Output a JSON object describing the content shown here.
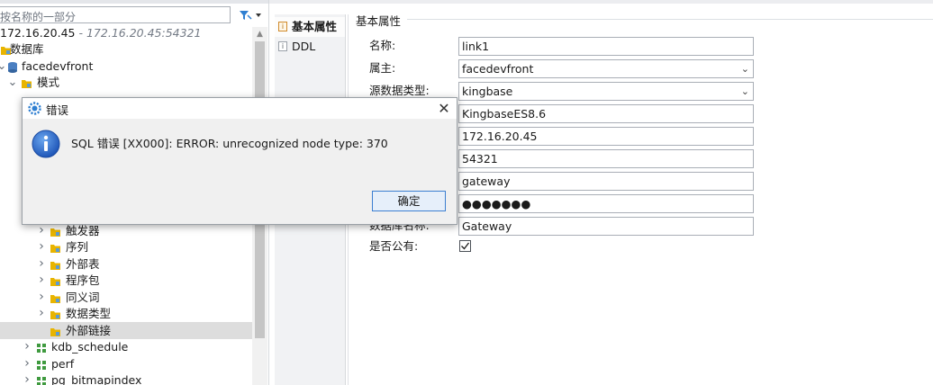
{
  "tree": {
    "filter_placeholder": "按名称的一部分",
    "connection": {
      "host": "172.16.20.45",
      "detail": "- 172.16.20.45:54321"
    },
    "rows": [
      {
        "label": "数据库",
        "chevron": "",
        "icon": "folder"
      },
      {
        "label": "facedevfront",
        "chevron": "v",
        "icon": "db"
      },
      {
        "label": "模式",
        "chevron": "v",
        "icon": "folder"
      },
      {
        "label": "触发器",
        "chevron": ">",
        "icon": "folder"
      },
      {
        "label": "序列",
        "chevron": ">",
        "icon": "folder"
      },
      {
        "label": "外部表",
        "chevron": ">",
        "icon": "folder"
      },
      {
        "label": "程序包",
        "chevron": ">",
        "icon": "folder"
      },
      {
        "label": "同义词",
        "chevron": ">",
        "icon": "folder"
      },
      {
        "label": "数据类型",
        "chevron": ">",
        "icon": "folder"
      },
      {
        "label": "外部链接",
        "chevron": "",
        "icon": "folder"
      },
      {
        "label": "kdb_schedule",
        "chevron": ">",
        "icon": "schema"
      },
      {
        "label": "perf",
        "chevron": ">",
        "icon": "schema"
      },
      {
        "label": "pg_bitmapindex",
        "chevron": ">",
        "icon": "schema"
      }
    ]
  },
  "tabs": [
    {
      "label": "基本属性",
      "active": true
    },
    {
      "label": "DDL",
      "active": false
    }
  ],
  "panel": {
    "section_title": "基本属性",
    "fields": [
      {
        "label": "名称:",
        "value": "link1",
        "dropdown": false
      },
      {
        "label": "属主:",
        "value": "facedevfront",
        "dropdown": true
      },
      {
        "label": "源数据类型:",
        "value": "kingbase",
        "dropdown": true
      },
      {
        "label": "",
        "value": "KingbaseES8.6",
        "dropdown": false
      },
      {
        "label": "",
        "value": "172.16.20.45",
        "dropdown": false
      },
      {
        "label": "",
        "value": "54321",
        "dropdown": false
      },
      {
        "label": "",
        "value": "gateway",
        "dropdown": false
      },
      {
        "label": "",
        "value": "●●●●●●●",
        "dropdown": false
      },
      {
        "label": "数据库名称:",
        "value": "Gateway",
        "dropdown": false
      }
    ],
    "public_label": "是否公有:",
    "public_checked": true
  },
  "dialog": {
    "title": "错误",
    "message": "SQL 错误 [XX000]: ERROR: unrecognized node type: 370",
    "ok_label": "确定",
    "close_glyph": "✕"
  },
  "colors": {
    "folder": "#e8b400",
    "schema": "#3f9a3f",
    "db": "#4a7fc1",
    "info": "#2f6fce"
  }
}
